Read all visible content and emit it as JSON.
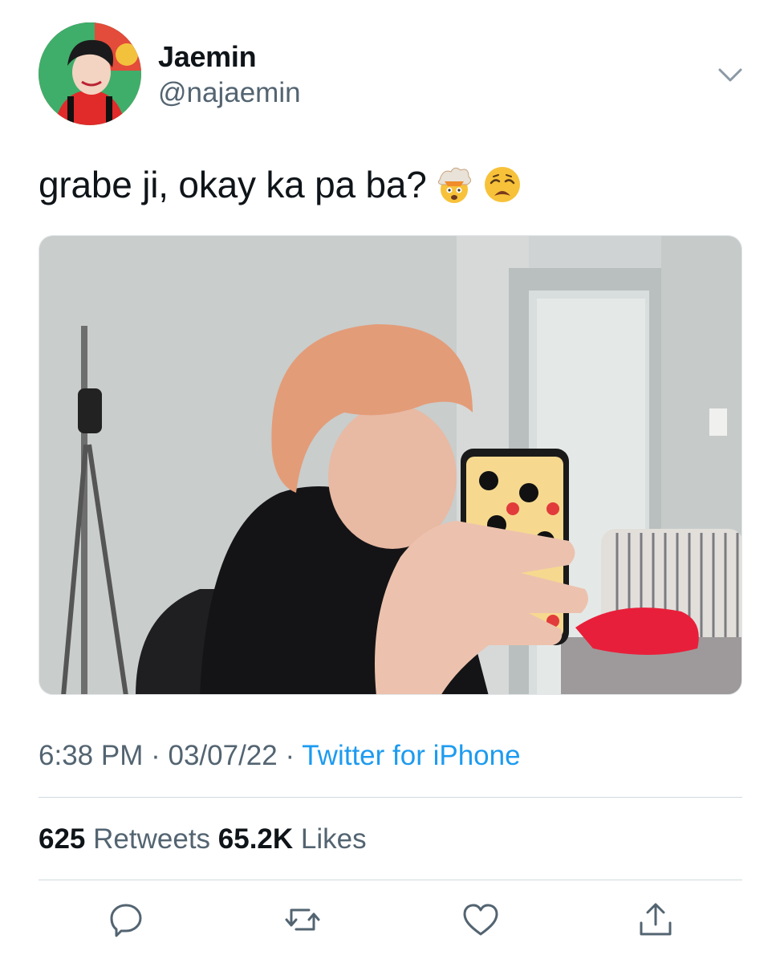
{
  "author": {
    "display_name": "Jaemin",
    "handle": "@najaemin",
    "avatar_icon": "profile-photo"
  },
  "tweet": {
    "text": "grabe ji, okay ka pa ba?",
    "emojis": [
      "exploding-head-emoji",
      "weary-face-emoji"
    ],
    "media_alt": "photo"
  },
  "meta": {
    "time": "6:38 PM",
    "sep1": "·",
    "date": "03/07/22",
    "sep2": "·",
    "source": "Twitter for iPhone"
  },
  "stats": {
    "retweets_count": "625",
    "retweets_label": "Retweets",
    "likes_count": "65.2K",
    "likes_label": "Likes"
  },
  "actions": [
    "reply-icon",
    "retweet-icon",
    "like-icon",
    "share-icon"
  ],
  "colors": {
    "link": "#1d9bf0",
    "secondary_text": "#536471",
    "divider": "#cfd9de"
  }
}
